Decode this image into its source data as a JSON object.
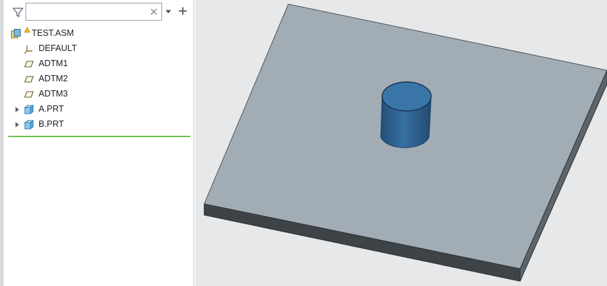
{
  "filter": {
    "search_value": "",
    "search_placeholder": "",
    "filter_icon": "filter-funnel-icon",
    "clear_icon": "clear-x-icon",
    "dropdown_icon": "chevron-down-icon",
    "add_icon": "plus-icon"
  },
  "tree": {
    "root": {
      "label": "TEST.ASM",
      "icon": "assembly-icon",
      "warning_icon": "warning-triangle-icon"
    },
    "items": [
      {
        "label": "DEFAULT",
        "icon": "coordinate-system-icon",
        "expandable": false
      },
      {
        "label": "ADTM1",
        "icon": "datum-plane-icon",
        "expandable": false
      },
      {
        "label": "ADTM2",
        "icon": "datum-plane-icon",
        "expandable": false
      },
      {
        "label": "ADTM3",
        "icon": "datum-plane-icon",
        "expandable": false
      },
      {
        "label": "A.PRT",
        "icon": "part-icon",
        "expandable": true
      },
      {
        "label": "B.PRT",
        "icon": "part-icon",
        "expandable": true
      }
    ],
    "insert_here_color": "#6cc14a"
  },
  "viewport": {
    "background": "#e7e8ea",
    "plate_top_color": "#a1acb5",
    "plate_side_color": "#3e4348",
    "cylinder_color": "#2d5f8c",
    "cylinder_top_color": "#3a75a8"
  }
}
